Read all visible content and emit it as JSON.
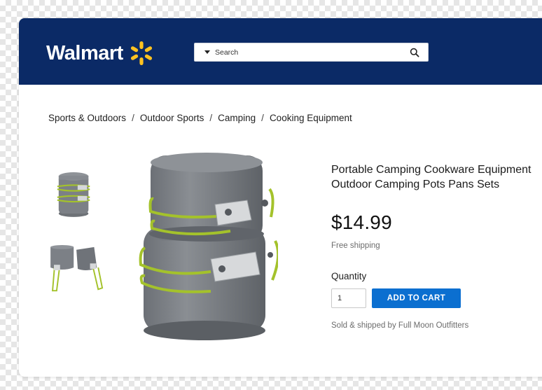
{
  "header": {
    "logo_text": "Walmart",
    "logo_icon": "spark-icon",
    "brand_color": "#0b2a66",
    "spark_color": "#ffc220"
  },
  "search": {
    "placeholder": "Search",
    "icon": "search-icon"
  },
  "breadcrumb": {
    "items": [
      "Sports & Outdoors",
      "Outdoor Sports",
      "Camping",
      "Cooking Equipment"
    ],
    "separator": "/"
  },
  "product": {
    "title_line1": "Portable Camping Cookware Equipment",
    "title_line2": "Outdoor Camping Pots Pans Sets",
    "price": "$14.99",
    "shipping": "Free shipping",
    "quantity_label": "Quantity",
    "quantity_value": "1",
    "add_to_cart_label": "ADD TO CART",
    "seller": "Sold & shipped by Full Moon Outfitters",
    "button_color": "#0b6fd0"
  }
}
